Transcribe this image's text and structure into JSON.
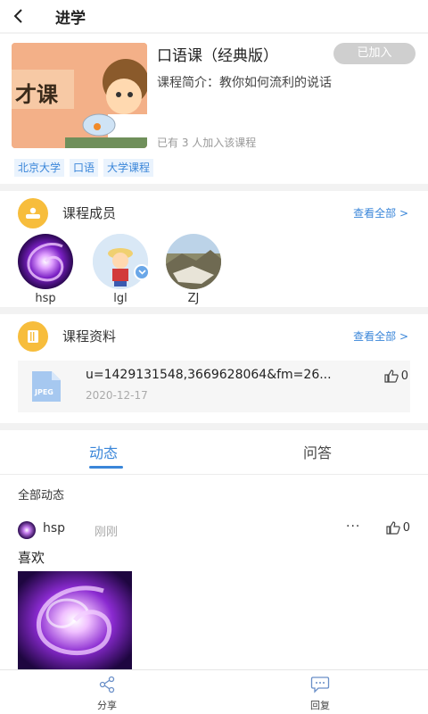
{
  "header": {
    "title": "进学"
  },
  "course": {
    "cover_text": "才课",
    "title": "口语课（经典版）",
    "join_label": "已加入",
    "description": "课程简介：教你如何流利的说话",
    "member_count": "已有 3 人加入该课程",
    "tags": [
      "北京大学",
      "口语",
      "大学课程"
    ]
  },
  "members_section": {
    "title": "课程成员",
    "see_all": "查看全部 >",
    "members": [
      {
        "name": "hsp"
      },
      {
        "name": "lgl"
      },
      {
        "name": "ZJ"
      }
    ]
  },
  "materials_section": {
    "title": "课程资料",
    "see_all": "查看全部 >",
    "file": {
      "type_label": "JPEG",
      "name": "u=1429131548,3669628064&fm=26...",
      "date": "2020-12-17",
      "likes": "0"
    }
  },
  "tabs": {
    "dynamic": "动态",
    "qa": "问答"
  },
  "feed": {
    "title": "全部动态",
    "post": {
      "user": "hsp",
      "time": "刚刚",
      "more": "···",
      "likes": "0",
      "text": "喜欢"
    }
  },
  "bottom": {
    "share": "分享",
    "reply": "回复"
  },
  "colors": {
    "accent": "#3a86d9",
    "section_icon": "#f7bd3c",
    "join_bg": "#cfcfcf"
  }
}
